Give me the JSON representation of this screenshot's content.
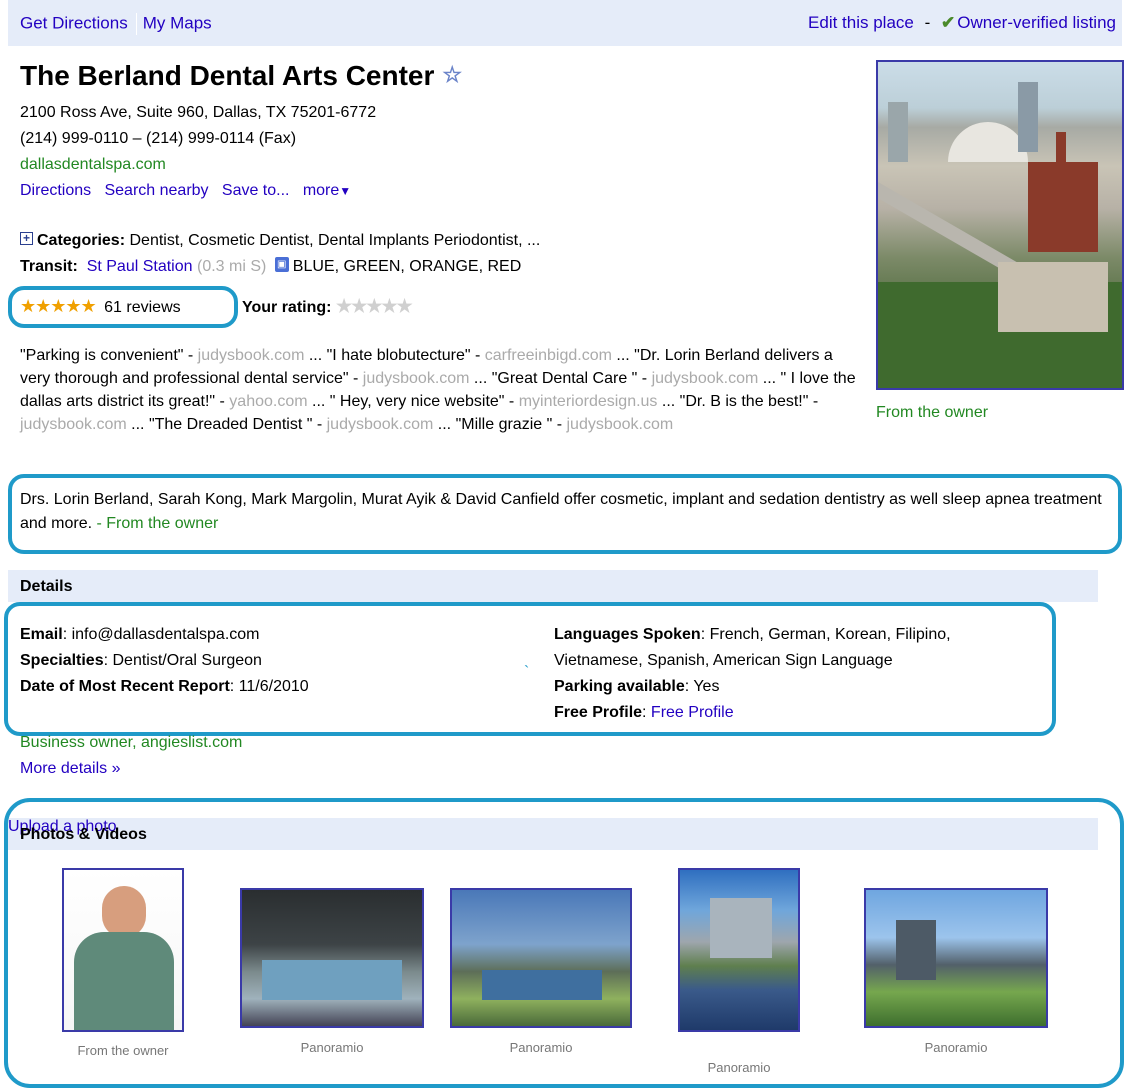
{
  "topbar": {
    "get_directions": "Get Directions",
    "my_maps": "My Maps",
    "edit_place": "Edit this place",
    "dash": "-",
    "verified": "Owner-verified listing"
  },
  "place": {
    "name": "The Berland Dental Arts Center",
    "address": "2100 Ross Ave, Suite 960, Dallas, TX 75201-6772",
    "phone": "(214) 999-0110 – (214) 999-0114 (Fax)",
    "website": "dallasdentalspa.com",
    "actions": {
      "directions": "Directions",
      "search_nearby": "Search nearby",
      "save_to": "Save to...",
      "more": "more"
    }
  },
  "categories": {
    "label": "Categories:",
    "value": "Dentist, Cosmetic Dentist, Dental Implants Periodontist, ..."
  },
  "transit": {
    "label": "Transit:",
    "station": "St Paul Station",
    "distance": "(0.3 mi S)",
    "lines": "BLUE, GREEN, ORANGE, RED"
  },
  "rating": {
    "stars": 5,
    "reviews": "61 reviews",
    "your_rating_label": "Your rating:"
  },
  "quotes": [
    {
      "text": "\"Parking is convenient\"",
      "source": "judysbook.com"
    },
    {
      "text": "\"I hate blobutecture\"",
      "source": "carfreeinbigd.com"
    },
    {
      "text": "\"Dr. Lorin Berland delivers a very thorough and professional dental service\"",
      "source": "judysbook.com"
    },
    {
      "text": "\"Great Dental Care \"",
      "source": "judysbook.com"
    },
    {
      "text": "\" I love the dallas arts district its great!\"",
      "source": "yahoo.com"
    },
    {
      "text": "\" Hey, very nice website\"",
      "source": "myinteriordesign.us"
    },
    {
      "text": "\"Dr. B is the best!\"",
      "source": "judysbook.com"
    },
    {
      "text": "\"The Dreaded Dentist \"",
      "source": "judysbook.com"
    },
    {
      "text": "\"Mille grazie \"",
      "source": "judysbook.com"
    }
  ],
  "main_photo_caption": "From the owner",
  "description": {
    "text": "Drs. Lorin Berland, Sarah Kong, Mark Margolin, Murat Ayik & David Canfield offer cosmetic, implant and sedation dentistry as well sleep apnea treatment and more.",
    "source": "- From the owner"
  },
  "details": {
    "header": "Details",
    "email_label": "Email",
    "email": "info@dallasdentalspa.com",
    "specialties_label": "Specialties",
    "specialties": "Dentist/Oral Surgeon",
    "report_label": "Date of Most Recent Report",
    "report": "11/6/2010",
    "languages_label": "Languages Spoken",
    "languages_1": "French, German, Korean, Filipino,",
    "languages_2": "Vietnamese, Spanish, American Sign Language",
    "parking_label": "Parking available",
    "parking": "Yes",
    "profile_label": "Free Profile",
    "profile": "Free Profile",
    "stray_mark": "`",
    "source": "Business owner, angieslist.com",
    "more": "More details »"
  },
  "photos": {
    "header": "Photos & Videos",
    "upload": "Upload a photo",
    "captions": [
      "From the owner",
      "Panoramio",
      "Panoramio",
      "Panoramio",
      "Panoramio"
    ]
  },
  "colors": {
    "link": "#2200c1",
    "green": "#228822",
    "header_bg": "#e5ecf9",
    "highlight": "#1f9ac9",
    "star": "#f0a000"
  }
}
